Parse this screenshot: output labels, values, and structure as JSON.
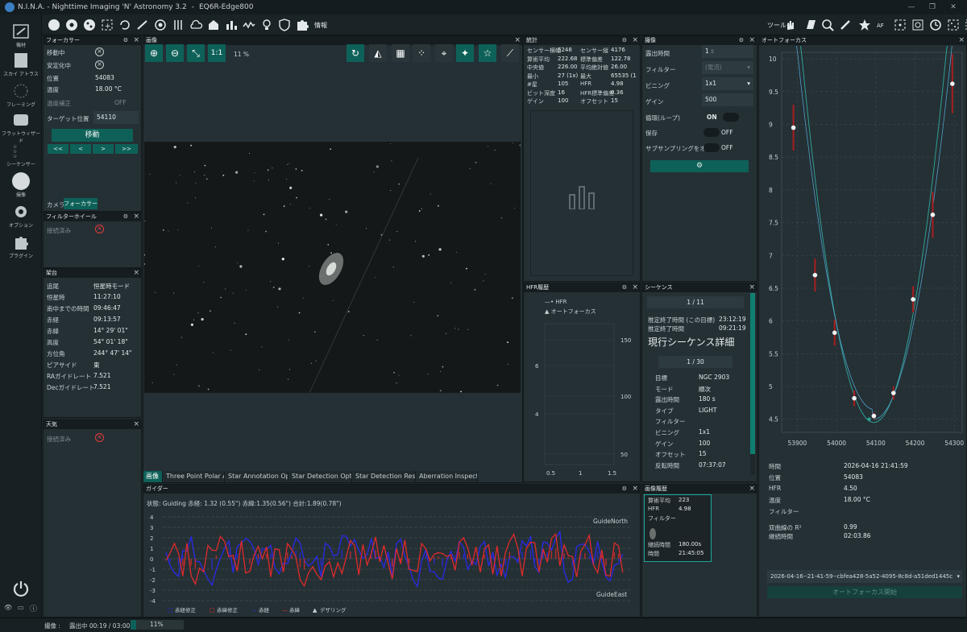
{
  "app": {
    "title": "N.I.N.A. - Nighttime Imaging 'N' Astronomy 3.2",
    "profile": "EQ6R-Edge800"
  },
  "sidebar": {
    "items": [
      {
        "label": "機材",
        "icon": "telescope-icon"
      },
      {
        "label": "スカイ アトラス",
        "icon": "sky-atlas-icon"
      },
      {
        "label": "フレーミング",
        "icon": "framing-icon"
      },
      {
        "label": "フラットウィザード",
        "icon": "flat-wizard-icon"
      },
      {
        "label": "シーケンサー",
        "icon": "sequencer-icon"
      },
      {
        "label": "撮像",
        "icon": "imaging-icon"
      },
      {
        "label": "オプション",
        "icon": "options-icon"
      },
      {
        "label": "プラグイン",
        "icon": "plugins-icon"
      }
    ],
    "collapse": "<<"
  },
  "toolbar": {
    "info_label": "情報",
    "tools_label": "ツール"
  },
  "focuser": {
    "title": "フォーカサー",
    "moving_label": "移動中",
    "settled_label": "安定化中",
    "position_label": "位置",
    "position": "54083",
    "temp_label": "温度",
    "temp": "18.00 °C",
    "tempcomp_label": "温度補正",
    "tempcomp": "OFF",
    "target_label": "ターゲット位置",
    "target": "54110",
    "move_btn": "移動",
    "steps": [
      "<<",
      "<",
      ">",
      ">>"
    ],
    "tab_camera": "カメラ",
    "tab_focuser": "フォーカサー"
  },
  "filterwheel": {
    "title": "フィルターホイール",
    "connected_label": "接続済み"
  },
  "mount": {
    "title": "架台",
    "rows": [
      [
        "追尾",
        "恒星時モード"
      ],
      [
        "恒星時",
        "11:27:10"
      ],
      [
        "南中までの時間",
        "09:46:47"
      ],
      [
        "赤経",
        "09:13:57"
      ],
      [
        "赤緯",
        "14° 29' 01\""
      ],
      [
        "高度",
        "54° 01' 18\""
      ],
      [
        "方位角",
        "244° 47' 14\""
      ],
      [
        "ピアサイド",
        "東"
      ],
      [
        "RAガイドレート",
        "7.521"
      ],
      [
        "Decガイドレート",
        "7.521"
      ]
    ]
  },
  "weather": {
    "title": "天気",
    "connected_label": "接続済み"
  },
  "image": {
    "title": "画像",
    "zoom": "11 %",
    "one_to_one": "1:1",
    "tabs": [
      "画像",
      "Three Point Polar Ali",
      "Star Annotation Opt",
      "Star Detection Optic",
      "Star Detection Resul",
      "Aberration Inspecto"
    ]
  },
  "stats": {
    "title": "統計",
    "rows": [
      [
        "センサー横幅",
        "6248",
        "センサー縦",
        "4176"
      ],
      [
        "算術平均",
        "222.68",
        "標準偏差",
        "122.78"
      ],
      [
        "中央値",
        "226.00",
        "平均絶対値",
        "26.00"
      ],
      [
        "最小",
        "27 (1x)",
        "最大",
        "65535 (1"
      ],
      [
        "#星",
        "105",
        "HFR",
        "4.98"
      ],
      [
        "ビット深度",
        "16",
        "HFR標準偏差",
        "0.36"
      ],
      [
        "ゲイン",
        "100",
        "オフセット",
        "15"
      ]
    ]
  },
  "imaging": {
    "title": "撮像",
    "exposure_label": "露出時間",
    "exposure": "1",
    "exposure_unit": "s",
    "filter_label": "フィルター",
    "filter": "(電流)",
    "binning_label": "ビニング",
    "binning": "1x1",
    "gain_label": "ゲイン",
    "gain": "500",
    "loop_label": "循環(ループ)",
    "loop": "ON",
    "save_label": "保存",
    "save": "OFF",
    "subsample_label": "サブサンプリングをオン",
    "subsample": "OFF"
  },
  "hfr": {
    "title": "HFR履歴",
    "legend_hfr": "HFR",
    "legend_af": "オートフォーカス",
    "y_left": [
      "6",
      "4"
    ],
    "y_right": [
      "150",
      "100",
      "50"
    ],
    "x": [
      "0.5",
      "1",
      "1.5"
    ]
  },
  "sequence": {
    "title": "シーケンス",
    "progress": "1 / 11",
    "eta_target_label": "推定終了時間 (この目標)",
    "eta_target": "23:12:19",
    "eta_label": "推定終了時間",
    "eta": "09:21:19",
    "detail_title": "現行シーケンス詳細",
    "sub_progress": "1 / 30",
    "rows": [
      [
        "目標",
        "NGC 2903"
      ],
      [
        "モード",
        "順次"
      ],
      [
        "露出時間",
        "180 s"
      ],
      [
        "タイプ",
        "LIGHT"
      ],
      [
        "フィルター",
        ""
      ],
      [
        "ビニング",
        "1x1"
      ],
      [
        "ゲイン",
        "100"
      ],
      [
        "オフセット",
        "15"
      ],
      [
        "反転時間",
        "07:37:07"
      ]
    ]
  },
  "guider": {
    "title": "ガイダー",
    "status": "状態: Guiding  赤経: 1.32 (0.55\")  赤緯:1.35(0.56\")  合計:1.89(0.78\")",
    "y": [
      "4",
      "3",
      "2",
      "1",
      "0",
      "-1",
      "-2",
      "-3",
      "-4"
    ],
    "north": "GuideNorth",
    "east": "GuideEast",
    "legend": [
      "赤経修正",
      "赤緯修正",
      "赤経",
      "赤緯",
      "デザリング"
    ]
  },
  "history": {
    "title": "画像履歴",
    "mean_label": "算術平均",
    "mean": "223",
    "hfr_label": "HFR",
    "hfr": "4.98",
    "filter_label": "フィルター",
    "duration_label": "継続時間",
    "duration": "180.00s",
    "time_label": "時間",
    "time": "21:45:05"
  },
  "autofocus": {
    "title": "オートフォーカス",
    "y": [
      "10",
      "9.5",
      "9",
      "8.5",
      "8",
      "7.5",
      "7",
      "6.5",
      "6",
      "5.5",
      "5",
      "4.5"
    ],
    "x": [
      "53900",
      "54000",
      "54100",
      "54200",
      "54300"
    ],
    "info": [
      [
        "時間",
        "2026-04-16 21:41:59"
      ],
      [
        "位置",
        "54083"
      ],
      [
        "HFR",
        "4.50"
      ],
      [
        "温度",
        "18.00 °C"
      ],
      [
        "フィルター",
        ""
      ]
    ],
    "r2_label": "双曲線の R²",
    "r2": "0.99",
    "dur_label": "継続時間",
    "dur": "02:03.86",
    "run": "2026-04-16--21-41-59--cbfea428-5a52-4095-8c8d-a51ded1445c",
    "start_btn": "オートフォーカス開始"
  },
  "status": {
    "label": "撮像 :",
    "text": "露出中 00:19 / 03:00",
    "percent": "11%",
    "progress": 0.11
  },
  "chart_data": [
    {
      "type": "scatter",
      "title": "オートフォーカス",
      "x": [
        53890,
        53945,
        53995,
        54045,
        54095,
        54145,
        54195,
        54245,
        54295
      ],
      "y": [
        8.95,
        6.7,
        5.82,
        4.82,
        4.55,
        4.9,
        6.33,
        7.62,
        9.62
      ],
      "xlim": [
        53860,
        54320
      ],
      "ylim": [
        4.3,
        10.1
      ]
    },
    {
      "type": "line",
      "title": "ガイダー",
      "ylim": [
        -4,
        4
      ],
      "series": [
        {
          "name": "赤経",
          "color": "#2a2ae8"
        },
        {
          "name": "赤緯",
          "color": "#e02a2a"
        }
      ]
    }
  ]
}
